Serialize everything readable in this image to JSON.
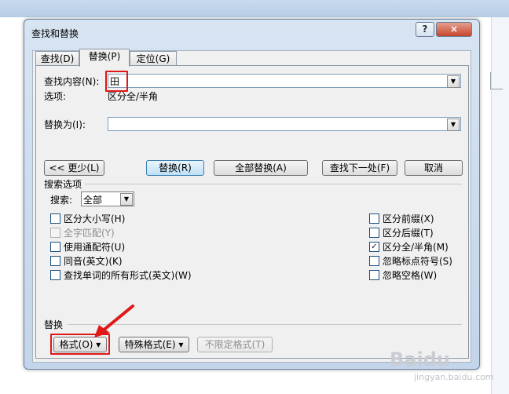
{
  "dialog": {
    "title": "查找和替换",
    "help": "?",
    "close": "×"
  },
  "tabs": [
    {
      "label": "查找(D)"
    },
    {
      "label": "替换(P)"
    },
    {
      "label": "定位(G)"
    }
  ],
  "find": {
    "label": "查找内容(N):",
    "value": "田",
    "options_label": "选项:",
    "options_value": "区分全/半角"
  },
  "replace": {
    "label": "替换为(I):",
    "value": ""
  },
  "buttons": {
    "less": "<< 更少(L)",
    "replace": "替换(R)",
    "replace_all": "全部替换(A)",
    "find_next": "查找下一处(F)",
    "cancel": "取消"
  },
  "search_options": {
    "section": "搜索选项",
    "search_label": "搜索:",
    "search_value": "全部",
    "left": [
      {
        "label": "区分大小写(H)",
        "checked": false,
        "disabled": false
      },
      {
        "label": "全字匹配(Y)",
        "checked": false,
        "disabled": true
      },
      {
        "label": "使用通配符(U)",
        "checked": false,
        "disabled": false
      },
      {
        "label": "同音(英文)(K)",
        "checked": false,
        "disabled": false
      },
      {
        "label": "查找单词的所有形式(英文)(W)",
        "checked": false,
        "disabled": false
      }
    ],
    "right": [
      {
        "label": "区分前缀(X)",
        "checked": false,
        "disabled": false
      },
      {
        "label": "区分后缀(T)",
        "checked": false,
        "disabled": false
      },
      {
        "label": "区分全/半角(M)",
        "checked": true,
        "disabled": false
      },
      {
        "label": "忽略标点符号(S)",
        "checked": false,
        "disabled": false
      },
      {
        "label": "忽略空格(W)",
        "checked": false,
        "disabled": false
      }
    ]
  },
  "replace_section": {
    "title": "替换",
    "format": "格式(O)",
    "special": "特殊格式(E)",
    "no_format": "不限定格式(T)"
  },
  "watermark": {
    "brand": "Baidu",
    "site": "jingyan.baidu.com"
  }
}
